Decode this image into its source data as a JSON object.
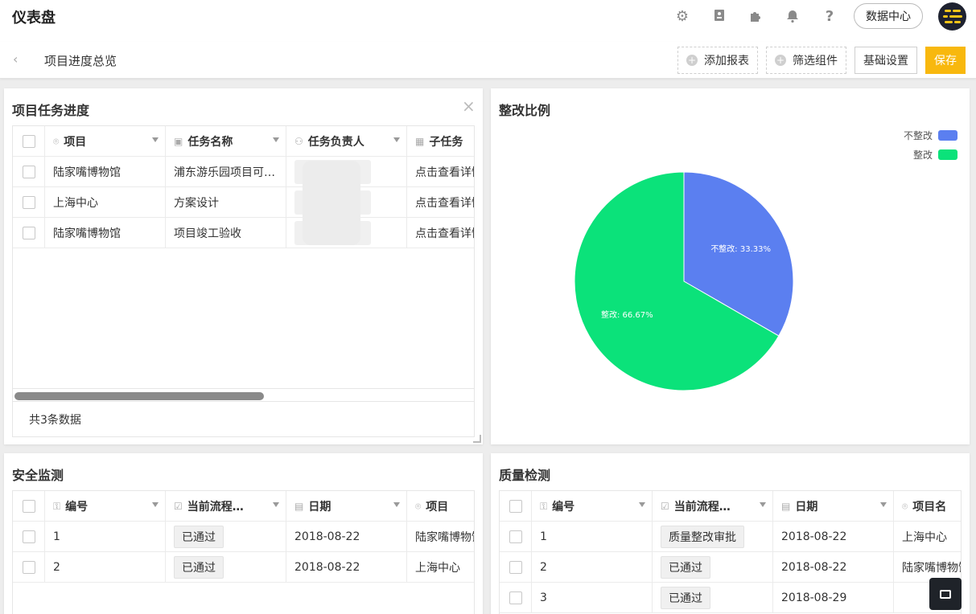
{
  "header": {
    "title": "仪表盘",
    "data_center": "数据中心"
  },
  "subbar": {
    "page_title": "项目进度总览",
    "add_report": "添加报表",
    "filter_component": "筛选组件",
    "basic_settings": "基础设置",
    "save": "保存"
  },
  "task_card": {
    "title": "项目任务进度",
    "columns": [
      "项目",
      "任务名称",
      "任务负责人",
      "子任务"
    ],
    "rows": [
      {
        "project": "陆家嘴博物馆",
        "task": "浦东游乐园项目可…",
        "subtask": "点击查看详情"
      },
      {
        "project": "上海中心",
        "task": "方案设计",
        "subtask": "点击查看详情"
      },
      {
        "project": "陆家嘴博物馆",
        "task": "项目竣工验收",
        "subtask": "点击查看详情"
      }
    ],
    "footer": "共3条数据"
  },
  "rect_card": {
    "title": "整改比例",
    "legend": [
      {
        "label": "不整改",
        "color": "#5b7ff0"
      },
      {
        "label": "整改",
        "color": "#0be27a"
      }
    ]
  },
  "chart_data": {
    "type": "pie",
    "title": "整改比例",
    "slices": [
      {
        "label": "不整改",
        "value": 33.33,
        "display": "不整改: 33.33%",
        "color": "#5b7ff0"
      },
      {
        "label": "整改",
        "value": 66.67,
        "display": "整改: 66.67%",
        "color": "#0be27a"
      }
    ],
    "legend_position": "top-right"
  },
  "safety_card": {
    "title": "安全监测",
    "columns": [
      "编号",
      "当前流程…",
      "日期",
      "项目"
    ],
    "rows": [
      {
        "id": "1",
        "status": "已通过",
        "date": "2018-08-22",
        "project": "陆家嘴博物馆"
      },
      {
        "id": "2",
        "status": "已通过",
        "date": "2018-08-22",
        "project": "上海中心"
      }
    ]
  },
  "quality_card": {
    "title": "质量检测",
    "columns": [
      "编号",
      "当前流程…",
      "日期",
      "项目名"
    ],
    "rows": [
      {
        "id": "1",
        "status": "质量整改审批",
        "date": "2018-08-22",
        "project": "上海中心"
      },
      {
        "id": "2",
        "status": "已通过",
        "date": "2018-08-22",
        "project": "陆家嘴博物馆"
      },
      {
        "id": "3",
        "status": "已通过",
        "date": "2018-08-29",
        "project": ""
      }
    ]
  }
}
